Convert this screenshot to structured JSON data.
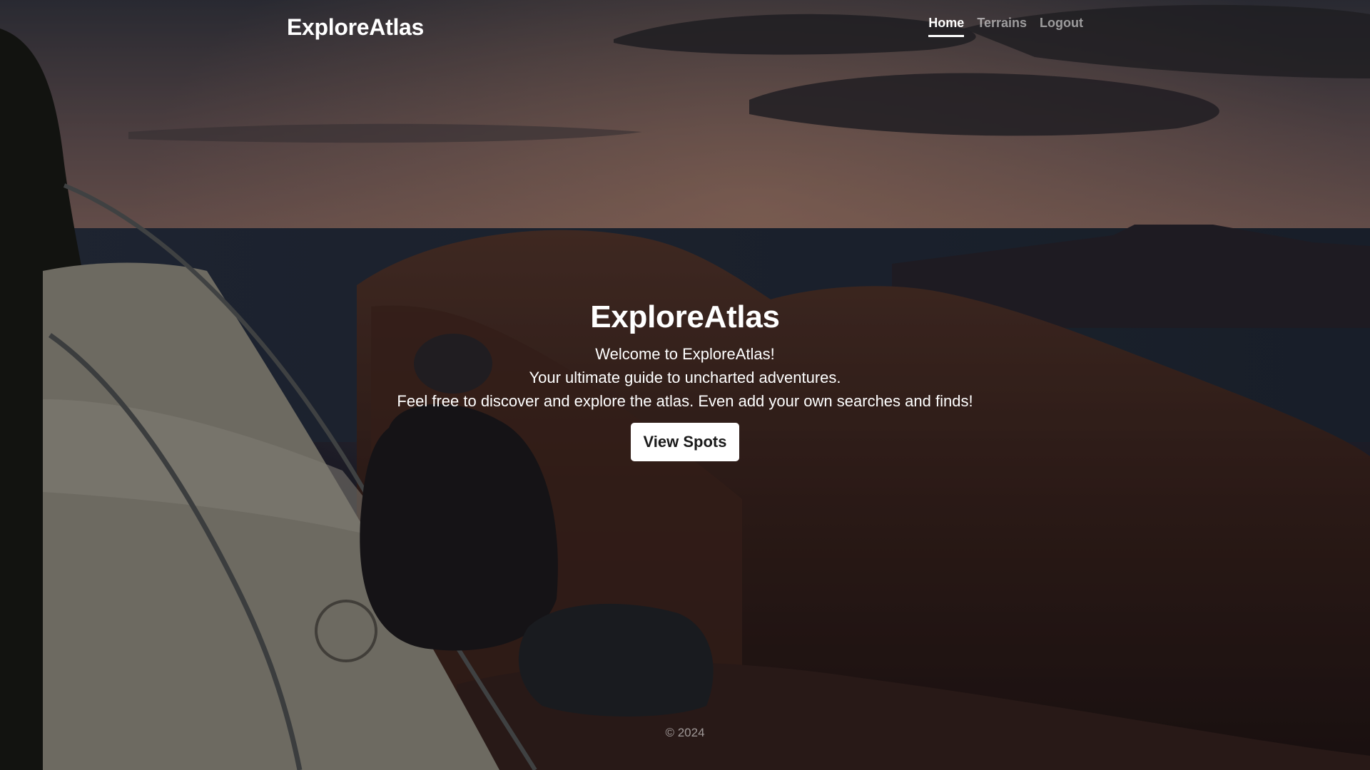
{
  "header": {
    "brand": "ExploreAtlas",
    "nav": [
      {
        "label": "Home",
        "active": true
      },
      {
        "label": "Terrains",
        "active": false
      },
      {
        "label": "Logout",
        "active": false
      }
    ]
  },
  "hero": {
    "title": "ExploreAtlas",
    "lines": [
      "Welcome to ExploreAtlas!",
      "Your ultimate guide to uncharted adventures.",
      "Feel free to discover and explore the atlas. Even add your own searches and finds!"
    ],
    "button_label": "View Spots"
  },
  "footer": {
    "text": "© 2024"
  },
  "background": {
    "description_colors": {
      "sky_top": "#3a3b45",
      "sky_glow": "#a27a6a",
      "mesa": "#3b2f3a",
      "canyon": "#4a2a22",
      "tent": "#b9b4a6"
    }
  }
}
